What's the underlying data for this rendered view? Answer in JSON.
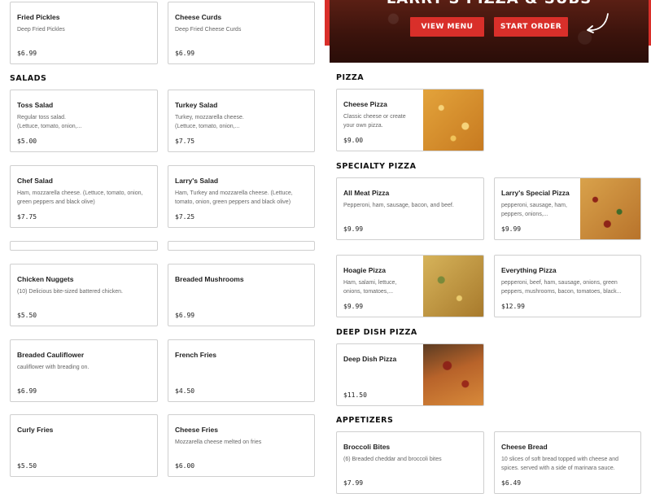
{
  "hero": {
    "title": "LARRY'S PIZZA & SUBS",
    "view_menu": "VIEW MENU",
    "start_order": "START ORDER",
    "accent": "#d92f2a"
  },
  "left_top": [
    {
      "name": "Fried Pickles",
      "desc": "Deep Fried Pickles",
      "price": "$6.99"
    },
    {
      "name": "Cheese Curds",
      "desc": "Deep Fried Cheese Curds",
      "price": "$6.99"
    }
  ],
  "salads": {
    "title": "SALADS",
    "items": [
      {
        "name": "Toss Salad",
        "desc1": "Regular toss salad.",
        "desc2": "(Lettuce, tomato, onion,...",
        "price": "$5.00"
      },
      {
        "name": "Turkey Salad",
        "desc1": "Turkey, mozzarella cheese.",
        "desc2": "(Lettuce, tomato, onion,...",
        "price": "$7.75"
      },
      {
        "name": "Chef Salad",
        "desc1": "Ham, mozzarella cheese. (Lettuce, tomato, onion,",
        "desc2": "green peppers and black olive)",
        "price": "$7.75"
      },
      {
        "name": "Larry's Salad",
        "desc1": "Ham, Turkey and mozzarella cheese. (Lettuce,",
        "desc2": "tomato, onion, green peppers and black olive)",
        "price": "$7.25"
      }
    ]
  },
  "sides": [
    {
      "name": "Chicken Nuggets",
      "desc": "(10) Delicious bite-sized battered chicken.",
      "price": "$5.50"
    },
    {
      "name": "Breaded Mushrooms",
      "desc": "",
      "price": "$6.99"
    },
    {
      "name": "Breaded Cauliflower",
      "desc": "cauliflower with breading on.",
      "price": "$6.99"
    },
    {
      "name": "French Fries",
      "desc": "",
      "price": "$4.50"
    },
    {
      "name": "Curly Fries",
      "desc": "",
      "price": "$5.50"
    },
    {
      "name": "Cheese Fries",
      "desc": "Mozzarella cheese melted on fries",
      "price": "$6.00"
    }
  ],
  "pizza": {
    "title": "PIZZA",
    "items": [
      {
        "name": "Cheese Pizza",
        "desc1": "Classic cheese or create",
        "desc2": "your own pizza.",
        "price": "$9.00",
        "photo_icon": "cheese-pizza-photo"
      }
    ]
  },
  "specialty": {
    "title": "SPECIALTY PIZZA",
    "items": [
      {
        "name": "All Meat Pizza",
        "desc1": "Pepperoni, ham, sausage, bacon, and beef.",
        "desc2": "",
        "price": "$9.99"
      },
      {
        "name": "Larry's Special Pizza",
        "desc1": "pepperoni, sausage, ham,",
        "desc2": "peppers, onions,...",
        "price": "$9.99"
      },
      {
        "name": "Hoagie Pizza",
        "desc1": "Ham, salami, lettuce,",
        "desc2": "onions, tomatoes,...",
        "price": "$9.99"
      },
      {
        "name": "Everything Pizza",
        "desc1": "pepperoni, beef, ham, sausage, onions, green",
        "desc2": "peppers, mushrooms, bacon, tomatoes, black...",
        "price": "$12.99"
      }
    ]
  },
  "deep_dish": {
    "title": "DEEP DISH PIZZA",
    "items": [
      {
        "name": "Deep Dish Pizza",
        "price": "$11.50"
      }
    ]
  },
  "appetizers": {
    "title": "APPETIZERS",
    "items": [
      {
        "name": "Broccoli Bites",
        "desc1": "(6) Breaded cheddar and broccoli bites",
        "desc2": "",
        "price": "$7.99"
      },
      {
        "name": "Cheese Bread",
        "desc1": "10 slices of soft bread topped with cheese and",
        "desc2": "spices. served with a side of marinara sauce.",
        "price": "$6.49"
      }
    ]
  }
}
